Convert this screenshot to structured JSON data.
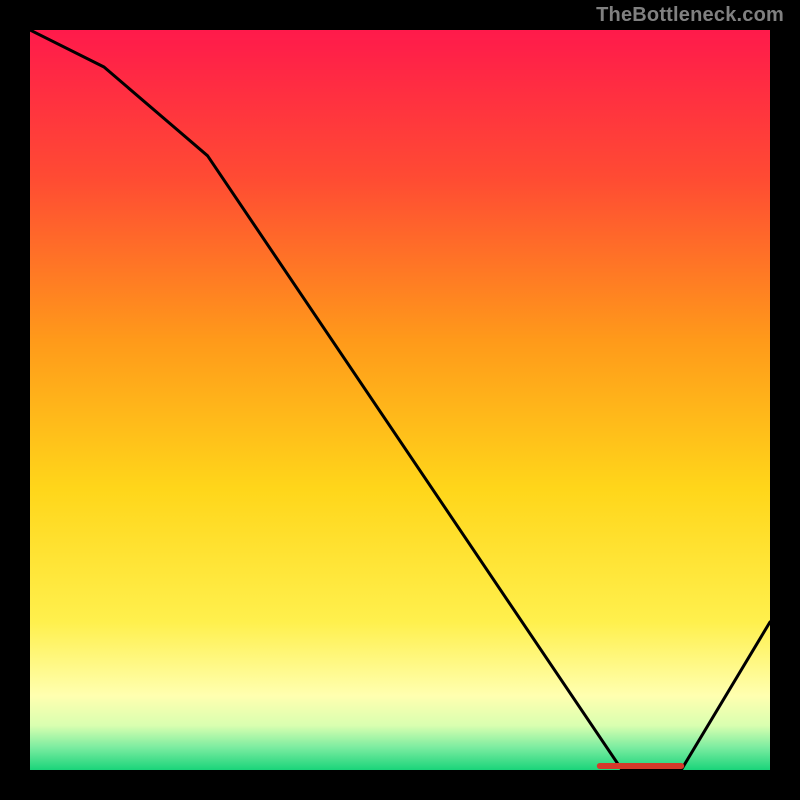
{
  "attribution": "TheBottleneck.com",
  "chart_data": {
    "type": "line",
    "xlabel": "",
    "ylabel": "",
    "xlim": [
      0,
      100
    ],
    "ylim": [
      0,
      100
    ],
    "series": [
      {
        "name": "curve",
        "x": [
          0,
          10,
          24,
          80,
          88,
          100
        ],
        "values": [
          100,
          95,
          83,
          0,
          0,
          20
        ]
      }
    ],
    "marker": {
      "name": "red-segment",
      "x": [
        77,
        88
      ],
      "y": [
        0,
        0
      ]
    },
    "gradient_stops": [
      {
        "offset": 0.0,
        "color": "#ff1a4b"
      },
      {
        "offset": 0.2,
        "color": "#ff4b33"
      },
      {
        "offset": 0.42,
        "color": "#ff9a1a"
      },
      {
        "offset": 0.62,
        "color": "#ffd61a"
      },
      {
        "offset": 0.8,
        "color": "#fff04d"
      },
      {
        "offset": 0.9,
        "color": "#ffffb0"
      },
      {
        "offset": 0.94,
        "color": "#d9ffb0"
      },
      {
        "offset": 0.97,
        "color": "#7aeca0"
      },
      {
        "offset": 1.0,
        "color": "#1ad47a"
      }
    ]
  }
}
